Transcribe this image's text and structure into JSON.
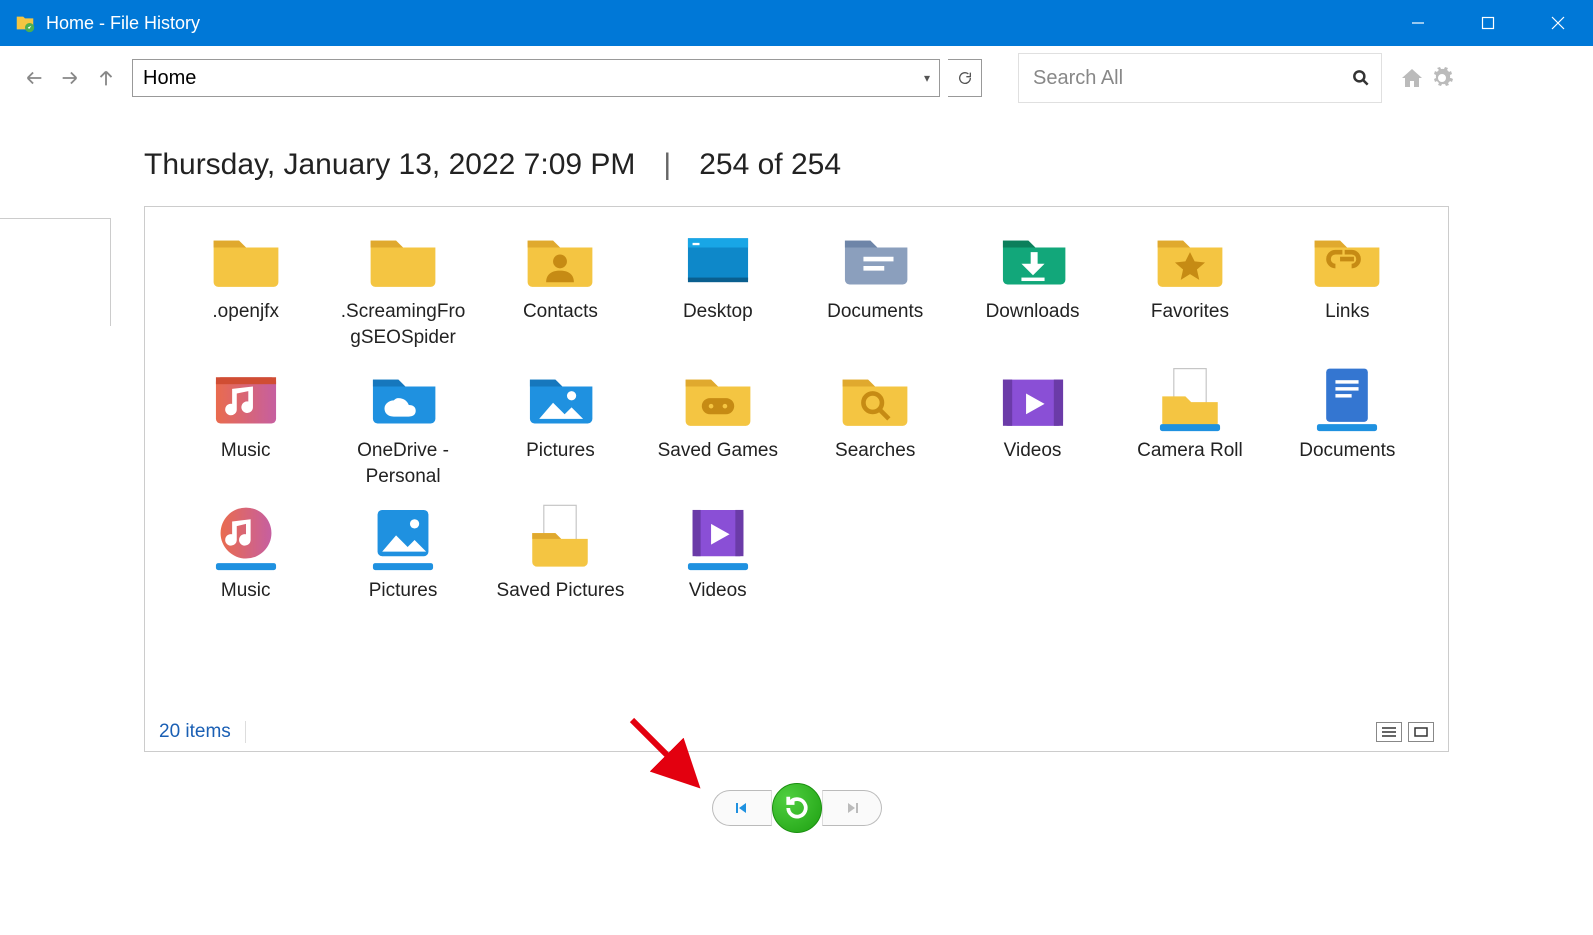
{
  "titlebar": {
    "title": "Home - File History"
  },
  "nav": {
    "address": "Home",
    "search_placeholder": "Search All"
  },
  "timeline": {
    "timestamp": "Thursday, January 13, 2022 7:09 PM",
    "position": "254 of 254"
  },
  "statusbar": {
    "count": "20 items"
  },
  "folders": [
    {
      "label": ".openjfx",
      "icon": "folder-plain"
    },
    {
      "label": ".ScreamingFrogSEOSpider",
      "icon": "folder-plain"
    },
    {
      "label": "Contacts",
      "icon": "folder-contacts"
    },
    {
      "label": "Desktop",
      "icon": "folder-desktop"
    },
    {
      "label": "Documents",
      "icon": "folder-documents"
    },
    {
      "label": "Downloads",
      "icon": "folder-downloads"
    },
    {
      "label": "Favorites",
      "icon": "folder-favorites"
    },
    {
      "label": "Links",
      "icon": "folder-links"
    },
    {
      "label": "Music",
      "icon": "folder-music"
    },
    {
      "label": "OneDrive - Personal",
      "icon": "folder-onedrive"
    },
    {
      "label": "Pictures",
      "icon": "folder-pictures"
    },
    {
      "label": "Saved Games",
      "icon": "folder-games"
    },
    {
      "label": "Searches",
      "icon": "folder-searches"
    },
    {
      "label": "Videos",
      "icon": "folder-videos"
    },
    {
      "label": "Camera Roll",
      "icon": "library-camera"
    },
    {
      "label": "Documents",
      "icon": "library-documents"
    },
    {
      "label": "Music",
      "icon": "library-music"
    },
    {
      "label": "Pictures",
      "icon": "library-pictures"
    },
    {
      "label": "Saved Pictures",
      "icon": "library-savedpics"
    },
    {
      "label": "Videos",
      "icon": "library-videos"
    }
  ],
  "icons": {
    "folder-plain": "<svg viewBox='0 0 64 52'><path fill='#f4c542' d='M4 10h22l6 6h28v30a4 4 0 0 1-4 4H8a4 4 0 0 1-4-4z'/><path fill='#e0a92e' d='M4 10h22l6 6H4z'/></svg>",
    "folder-contacts": "<svg viewBox='0 0 64 52'><path fill='#f4c542' d='M4 10h22l6 6h28v30a4 4 0 0 1-4 4H8a4 4 0 0 1-4-4z'/><path fill='#e0a92e' d='M4 10h22l6 6H4z'/><circle cx='32' cy='28' r='6' fill='#c68b14'/><path fill='#c68b14' d='M20 46c0-7 5-10 12-10s12 3 12 10z'/></svg>",
    "folder-desktop": "<svg viewBox='0 0 64 52'><path fill='#0e88c9' d='M6 8h52v36H6z'/><path fill='#18a6e6' d='M6 8h52v8H6z'/><rect x='10' y='12' width='6' height='2' fill='#fff'/><rect x='6' y='42' width='52' height='4' fill='#0a5f8f'/></svg>",
    "folder-documents": "<svg viewBox='0 0 64 52'><path fill='#8b9fbd' d='M6 10h22l6 6h26v28a4 4 0 0 1-4 4H10a4 4 0 0 1-4-4z'/><path fill='#6e85a8' d='M6 10h22l6 6H6z'/><rect x='22' y='24' width='26' height='4' fill='#fff'/><rect x='22' y='32' width='18' height='4' fill='#fff'/></svg>",
    "folder-downloads": "<svg viewBox='0 0 64 52'><path fill='#12a77a' d='M6 10h22l6 6h26v28a4 4 0 0 1-4 4H10a4 4 0 0 1-4-4z'/><path fill='#0b7f5b' d='M6 10h22l6 6H6z'/><path fill='#fff' d='M30 20h6v10h6L32 40 22 30h8z'/><rect x='22' y='42' width='20' height='3' fill='#fff'/></svg>",
    "folder-favorites": "<svg viewBox='0 0 64 52'><path fill='#f4c542' d='M4 10h22l6 6h28v30a4 4 0 0 1-4 4H8a4 4 0 0 1-4-4z'/><path fill='#e0a92e' d='M4 10h22l6 6H4z'/><path fill='#c68b14' d='M32 20l4 8 9 1-7 6 2 9-8-5-8 5 2-9-7-6 9-1z'/></svg>",
    "folder-links": "<svg viewBox='0 0 64 52'><path fill='#f4c542' d='M4 10h22l6 6h28v30a4 4 0 0 1-4 4H8a4 4 0 0 1-4-4z'/><path fill='#e0a92e' d='M4 10h22l6 6H4z'/><path fill='none' stroke='#c68b14' stroke-width='4' d='M22 32a6 6 0 1 1 0-12h6m8 12a6 6 0 1 0 0-12h-6 M26 26h12'/></svg>",
    "folder-music": "<svg viewBox='0 0 64 52'><defs><linearGradient id='gm' x1='0' x2='1'><stop offset='0' stop-color='#e96b4e'/><stop offset='1' stop-color='#c65fa0'/></linearGradient></defs><rect x='6' y='8' width='52' height='40' rx='4' fill='url(#gm)'/><rect x='6' y='8' width='52' height='6' fill='#d04d33'/><path fill='#fff' d='M38 16v18a5 5 0 1 1-4-5V20l-10 2v14a5 5 0 1 1-4-5V18z'/></svg>",
    "folder-onedrive": "<svg viewBox='0 0 64 52'><path fill='#1f91e0' d='M6 10h22l6 6h26v28a4 4 0 0 1-4 4H10a4 4 0 0 1-4-4z'/><path fill='#1677bd' d='M6 10h22l6 6H6z'/><path fill='#fff' d='M28 26c5 0 8 3 9 6 4 0 6 2 6 5s-2 5-6 5H24c-5 0-8-3-8-7s4-7 8-7c1-1 2-2 4-2z'/></svg>",
    "folder-pictures": "<svg viewBox='0 0 64 52'><path fill='#1f91e0' d='M6 10h22l6 6h26v28a4 4 0 0 1-4 4H10a4 4 0 0 1-4-4z'/><path fill='#1677bd' d='M6 10h22l6 6H6z'/><circle cx='42' cy='24' r='4' fill='#fff'/><path fill='#fff' d='M14 44l12-14 10 10 6-6 10 10z'/></svg>",
    "folder-games": "<svg viewBox='0 0 64 52'><path fill='#f4c542' d='M4 10h22l6 6h28v30a4 4 0 0 1-4 4H8a4 4 0 0 1-4-4z'/><path fill='#e0a92e' d='M4 10h22l6 6H4z'/><rect x='18' y='26' width='28' height='14' rx='7' fill='#c68b14'/><circle cx='26' cy='33' r='2' fill='#f4c542'/><circle cx='38' cy='33' r='2' fill='#f4c542'/></svg>",
    "folder-searches": "<svg viewBox='0 0 64 52'><path fill='#f4c542' d='M4 10h22l6 6h28v30a4 4 0 0 1-4 4H8a4 4 0 0 1-4-4z'/><path fill='#e0a92e' d='M4 10h22l6 6H4z'/><circle cx='30' cy='30' r='8' fill='none' stroke='#c68b14' stroke-width='4'/><path stroke='#c68b14' stroke-width='4' d='M36 36l8 8'/></svg>",
    "folder-videos": "<svg viewBox='0 0 64 52'><path fill='#8a4fd6' d='M6 10h52v36a4 4 0 0 1-4 4H10a4 4 0 0 1-4-4z'/><rect x='6' y='10' width='8' height='40' fill='#6b3ba8'/><rect x='50' y='10' width='8' height='40' fill='#6b3ba8'/><path fill='#fff' d='M26 22v18l16-9z'/></svg>",
    "library-camera": "<svg viewBox='0 0 64 60'><rect x='18' y='4' width='28' height='36' fill='#fff' stroke='#c4c4c4'/><path fill='#f4c542' d='M8 28h20l5 5h23v18a4 4 0 0 1-4 4H12a4 4 0 0 1-4-4z'/><rect x='6' y='52' width='52' height='6' rx='2' fill='#1f91e0'/></svg>",
    "library-documents": "<svg viewBox='0 0 64 60'><rect x='14' y='4' width='36' height='46' rx='3' fill='#3476d1'/><rect x='22' y='14' width='20' height='3' fill='#fff'/><rect x='22' y='20' width='20' height='3' fill='#fff'/><rect x='22' y='26' width='14' height='3' fill='#fff'/><rect x='6' y='52' width='52' height='6' rx='2' fill='#1f91e0'/></svg>",
    "library-music": "<svg viewBox='0 0 64 60'><defs><linearGradient id='lm' x1='0' x2='1'><stop offset='0' stop-color='#e96b4e'/><stop offset='1' stop-color='#c65fa0'/></linearGradient></defs><circle cx='32' cy='26' r='22' fill='url(#lm)'/><path fill='#fff' d='M36 14v18a5 5 0 1 1-4-5V18l-8 2v12a5 5 0 1 1-4-5V16z'/><rect x='6' y='52' width='52' height='6' rx='2' fill='#1f91e0'/></svg>",
    "library-pictures": "<svg viewBox='0 0 64 60'><rect x='10' y='6' width='44' height='40' rx='4' fill='#1f91e0'/><circle cx='42' cy='18' r='4' fill='#fff'/><path fill='#fff' d='M14 42l12-14 10 10 6-6 10 10z'/><rect x='6' y='52' width='52' height='6' rx='2' fill='#1f91e0'/></svg>",
    "library-savedpics": "<svg viewBox='0 0 64 60'><rect x='18' y='2' width='28' height='36' fill='#fff' stroke='#c4c4c4'/><path fill='#f4c542' d='M8 26h20l5 5h23v20a4 4 0 0 1-4 4H12a4 4 0 0 1-4-4z'/><path fill='#e0a92e' d='M8 26h20l5 5H8z'/></svg>",
    "library-videos": "<svg viewBox='0 0 64 60'><rect x='10' y='6' width='44' height='40' rx='3' fill='#8a4fd6'/><rect x='10' y='6' width='7' height='40' fill='#6b3ba8'/><rect x='47' y='6' width='7' height='40' fill='#6b3ba8'/><path fill='#fff' d='M26 18v18l16-9z'/><rect x='6' y='52' width='52' height='6' rx='2' fill='#1f91e0'/></svg>"
  }
}
